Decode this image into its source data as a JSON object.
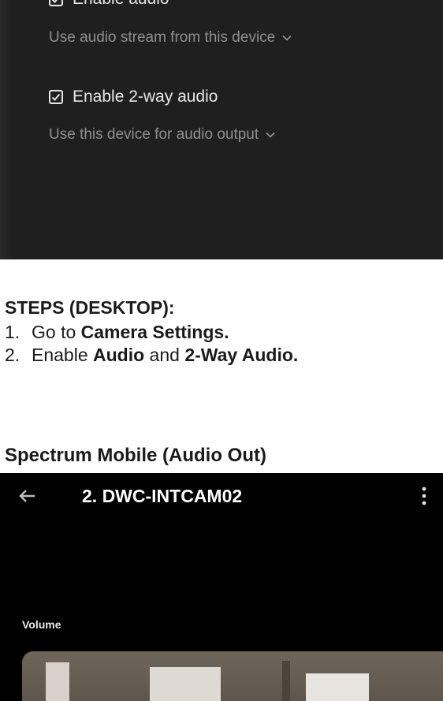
{
  "settings": {
    "enable_audio_label": "Enable audio",
    "audio_source_select": "Use audio stream from this device",
    "enable_2way_label": "Enable 2-way audio",
    "audio_output_select": "Use this device for audio output",
    "checkbox_checked": true,
    "text_color": "#e6e6e6",
    "muted_color": "#8f8f8f",
    "panel_color": "#1f1f1f"
  },
  "steps": {
    "title": "STEPS (DESKTOP):",
    "items": [
      {
        "num": "1.",
        "pre": "Go to ",
        "bold1": "Camera Settings.",
        "mid": "",
        "bold2": ""
      },
      {
        "num": "2.",
        "pre": "Enable ",
        "bold1": "Audio",
        "mid": " and ",
        "bold2": "2-Way Audio."
      }
    ]
  },
  "mobile_section": {
    "title": "Spectrum Mobile (Audio Out)",
    "app_title": "2. DWC-INTCAM02",
    "volume_label": "Volume",
    "icons": [
      "back-arrow-icon",
      "more-vertical-icon",
      "checkbox-checked-icon",
      "chevron-down-icon"
    ]
  }
}
